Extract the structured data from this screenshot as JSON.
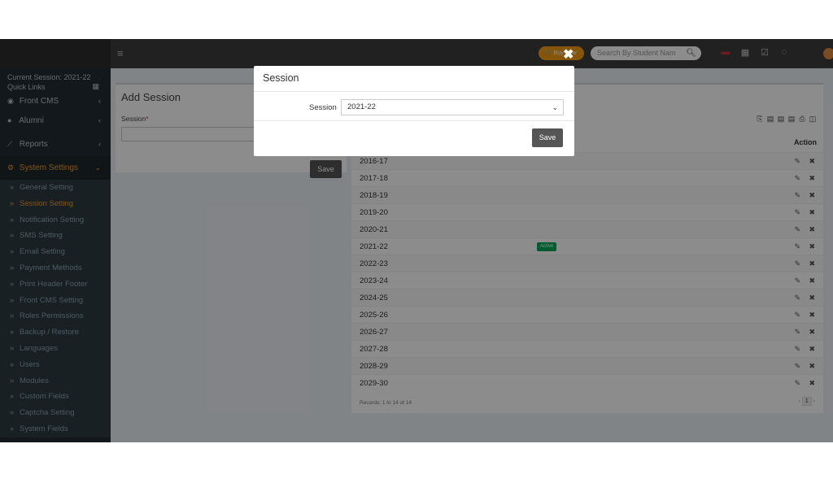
{
  "topbar": {
    "menu_icon": "hamburger-icon",
    "buy_label": "Buy Now",
    "search_placeholder": "Search By Student Nam",
    "search_icon": "search-icon",
    "icons": [
      "flag-icon",
      "calendar-icon",
      "checkbox-icon",
      "whatsapp-icon"
    ]
  },
  "sidebar": {
    "session_text": "Current Session: 2021-22",
    "quick_links": "Quick Links",
    "menus": [
      {
        "label": "Front CMS",
        "icon": "globe-icon",
        "chev": "‹"
      },
      {
        "label": "Alumni",
        "icon": "graduation-icon",
        "chev": "‹"
      },
      {
        "label": "Reports",
        "icon": "chart-icon",
        "chev": "‹"
      },
      {
        "label": "System Settings",
        "icon": "cogs-icon",
        "chev": "⌄"
      }
    ],
    "submenu": [
      "General Setting",
      "Session Setting",
      "Notification Setting",
      "SMS Setting",
      "Email Setting",
      "Payment Methods",
      "Print Header Footer",
      "Front CMS Setting",
      "Roles Permissions",
      "Backup / Restore",
      "Languages",
      "Users",
      "Modules",
      "Custom Fields",
      "Captcha Setting",
      "System Fields"
    ]
  },
  "add_session": {
    "title": "Add Session",
    "label": "Session",
    "required_mark": "*",
    "save_label": "Save"
  },
  "session_list": {
    "action_header": "Action",
    "rows": [
      {
        "session": "2016-17",
        "badge": ""
      },
      {
        "session": "2017-18",
        "badge": ""
      },
      {
        "session": "2018-19",
        "badge": ""
      },
      {
        "session": "2019-20",
        "badge": ""
      },
      {
        "session": "2020-21",
        "badge": ""
      },
      {
        "session": "2021-22",
        "badge": "Active"
      },
      {
        "session": "2022-23",
        "badge": ""
      },
      {
        "session": "2023-24",
        "badge": ""
      },
      {
        "session": "2024-25",
        "badge": ""
      },
      {
        "session": "2025-26",
        "badge": ""
      },
      {
        "session": "2026-27",
        "badge": ""
      },
      {
        "session": "2027-28",
        "badge": ""
      },
      {
        "session": "2028-29",
        "badge": ""
      },
      {
        "session": "2029-30",
        "badge": ""
      }
    ],
    "records_text": "Records: 1 to 14 of 14",
    "page_prev": "‹",
    "page_current": "1",
    "page_next": "›"
  },
  "modal": {
    "title": "Session",
    "label": "Session",
    "selected": "2021-22",
    "save_label": "Save",
    "close_glyph": "✖"
  },
  "colors": {
    "accent": "#f39c12",
    "sidebar_bg": "#222d32",
    "topbar_bg": "#3c3c3c",
    "active_badge": "#00a65a"
  }
}
